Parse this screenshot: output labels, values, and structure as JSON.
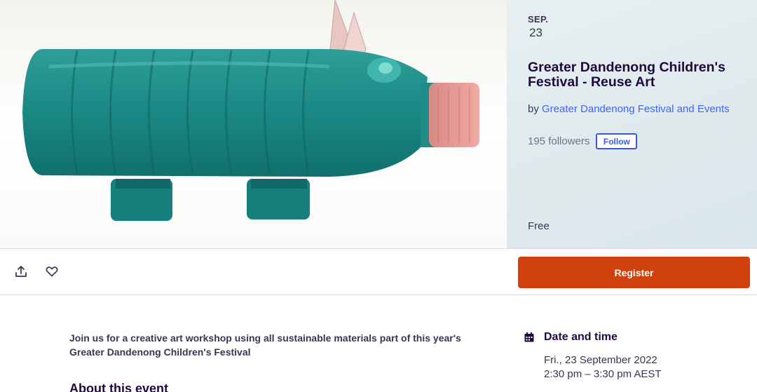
{
  "hero": {
    "image_alt": "teal plastic bottle pig sculpture",
    "date_month": "SEP.",
    "date_day": "23",
    "title": "Greater Dandenong Children's Festival - Reuse Art",
    "organizer_prefix": "by ",
    "organizer_name": "Greater Dandenong Festival and Events",
    "followers": "195 followers",
    "follow_label": "Follow",
    "price": "Free"
  },
  "actions": {
    "share_icon": "share-icon",
    "like_icon": "heart-icon",
    "register_label": "Register",
    "register_color": "#d1410c"
  },
  "body": {
    "summary": "Join us for a creative art workshop using all sustainable materials part of this year's Greater Dandenong Children's Festival",
    "about_heading": "About this event"
  },
  "datetime": {
    "icon": "calendar-icon",
    "heading": "Date and time",
    "date": "Fri., 23 September 2022",
    "time": "2:30 pm – 3:30 pm AEST"
  }
}
